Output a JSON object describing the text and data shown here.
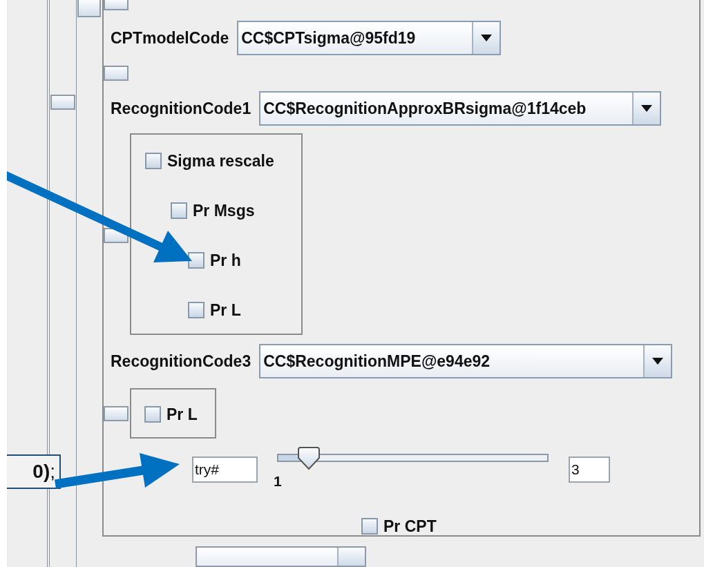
{
  "fields": [
    {
      "label": "CPTmodelCode",
      "value": "CC$CPTsigma@95fd19"
    },
    {
      "label": "RecognitionCode1",
      "value": "CC$RecognitionApproxBRsigma@1f14ceb"
    }
  ],
  "group1": {
    "checkboxes": [
      {
        "label": "Sigma rescale",
        "checked": false
      },
      {
        "label": "Pr Msgs",
        "checked": false
      },
      {
        "label": "Pr h",
        "checked": false
      },
      {
        "label": "Pr L",
        "checked": false
      }
    ]
  },
  "field3": {
    "label": "RecognitionCode3",
    "value": "CC$RecognitionMPE@e94e92"
  },
  "group2": {
    "checkboxes": [
      {
        "label": "Pr L",
        "checked": false
      }
    ]
  },
  "slider": {
    "field": "try#",
    "min_label": "1",
    "level": 0.08,
    "value": "3"
  },
  "pr_cpt": {
    "label": "Pr CPT",
    "checked": false
  },
  "callout": {
    "text": "**0)**;"
  }
}
